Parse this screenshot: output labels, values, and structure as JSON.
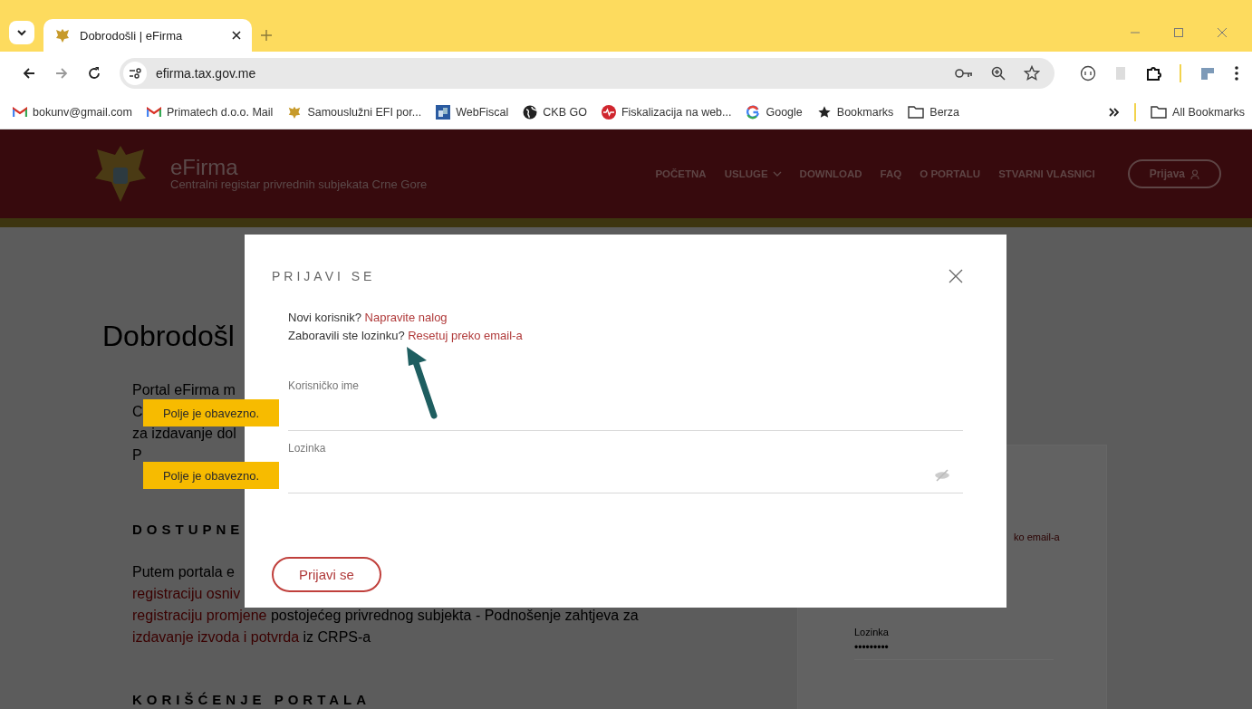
{
  "browser": {
    "tabs": [
      {
        "title": "Dobrodošli | eFirma",
        "selected": true
      }
    ],
    "address": "efirma.tax.gov.me",
    "bookmarks": [
      {
        "label": "bokunv@gmail.com",
        "kind": "gmail"
      },
      {
        "label": "Primatech d.o.o. Mail",
        "kind": "gmail"
      },
      {
        "label": "Samouslužni EFI por...",
        "kind": "crest"
      },
      {
        "label": "WebFiscal",
        "kind": "app"
      },
      {
        "label": "CKB GO",
        "kind": "globe"
      },
      {
        "label": "Fiskalizacija na web...",
        "kind": "pulse"
      },
      {
        "label": "Google",
        "kind": "google"
      },
      {
        "label": "Bookmarks",
        "kind": "star"
      },
      {
        "label": "Berza",
        "kind": "folder"
      }
    ],
    "all_bookmarks": "All Bookmarks"
  },
  "site_header": {
    "logo_title": "eFirma",
    "logo_subtitle": "Centralni registar privrednih subjekata Crne Gore",
    "nav": [
      {
        "label": "POČETNA",
        "dropdown": false
      },
      {
        "label": "USLUGE",
        "dropdown": true
      },
      {
        "label": "DOWNLOAD",
        "dropdown": false
      },
      {
        "label": "FAQ",
        "dropdown": false
      },
      {
        "label": "O PORTALU",
        "dropdown": false
      },
      {
        "label": "STVARNI VLASNICI",
        "dropdown": false
      }
    ],
    "login_button": "Prijava"
  },
  "page": {
    "heading": "Dobrodošl",
    "intro_lines": [
      "Portal eFirma m",
      "C",
      "za izdavanje dol",
      "P"
    ],
    "section_heading": "DOSTUPNE",
    "section_lines": [
      [
        {
          "text": "Putem portala e",
          "link": false
        }
      ],
      [
        {
          "text": "registraciju osniv",
          "link": true
        }
      ],
      [
        {
          "text": "registraciju promjene",
          "link": true
        },
        {
          "text": " postojećeg privrednog subjekta - Podnošenje zahtjeva za",
          "link": false
        }
      ],
      [
        {
          "text": "izdavanje izvoda i potvrda",
          "link": true
        },
        {
          "text": " iz CRPS-a",
          "link": false
        }
      ]
    ],
    "second_heading": "KORIŠĆENJE PORTALA",
    "side_card": {
      "partial_text": "ko email-a",
      "password_label": "Lozinka",
      "password_value": "•••••••••"
    }
  },
  "dialog": {
    "title": "PRIJAVI SE",
    "new_user_prompt": "Novi korisnik?",
    "new_user_link": "Napravite nalog",
    "forgot_prompt": "Zaboravili ste lozinku?",
    "forgot_link": "Resetuj preko email-a",
    "fields": [
      {
        "label": "Korisničko ime",
        "kind": "text",
        "error": "Polje je obavezno."
      },
      {
        "label": "Lozinka",
        "kind": "password",
        "error": "Polje je obavezno."
      }
    ],
    "submit": "Prijavi se"
  }
}
